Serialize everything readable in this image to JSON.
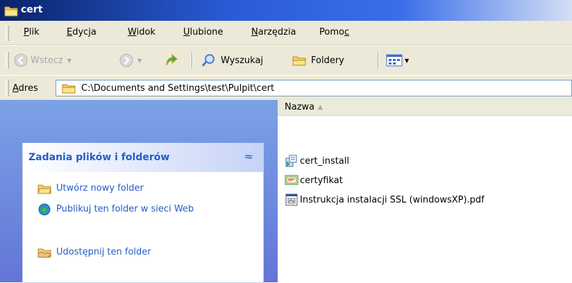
{
  "window": {
    "title": "cert"
  },
  "menubar": {
    "items": [
      {
        "label": "Plik",
        "mnemonic": "P"
      },
      {
        "label": "Edycja",
        "mnemonic": "E"
      },
      {
        "label": "Widok",
        "mnemonic": "W"
      },
      {
        "label": "Ulubione",
        "mnemonic": "U"
      },
      {
        "label": "Narzędzia",
        "mnemonic": "N"
      },
      {
        "label": "Pomoc",
        "mnemonic": "c"
      }
    ]
  },
  "toolbar": {
    "back_label": "Wstecz",
    "search_label": "Wyszukaj",
    "folders_label": "Foldery"
  },
  "address": {
    "label": "Adres",
    "value": "C:\\Documents and Settings\\test\\Pulpit\\cert"
  },
  "tasks": {
    "title": "Zadania plików i folderów",
    "items": [
      {
        "label": "Utwórz nowy folder",
        "icon": "new-folder-icon"
      },
      {
        "label": "Publikuj ten folder w sieci Web",
        "icon": "publish-web-icon"
      },
      {
        "label": "Udostępnij ten folder",
        "icon": "share-folder-icon"
      }
    ]
  },
  "files": {
    "column": "Nazwa",
    "items": [
      {
        "name": "cert_install",
        "icon": "installer-icon"
      },
      {
        "name": "certyfikat",
        "icon": "certificate-icon"
      },
      {
        "name": "Instrukcja instalacji SSL (windowsXP).pdf",
        "icon": "pdf-file-icon"
      }
    ]
  },
  "colors": {
    "title_bar": "#0a246a",
    "task_pane": "#6375d6",
    "task_text": "#215dc6",
    "chrome": "#ece9d8"
  }
}
